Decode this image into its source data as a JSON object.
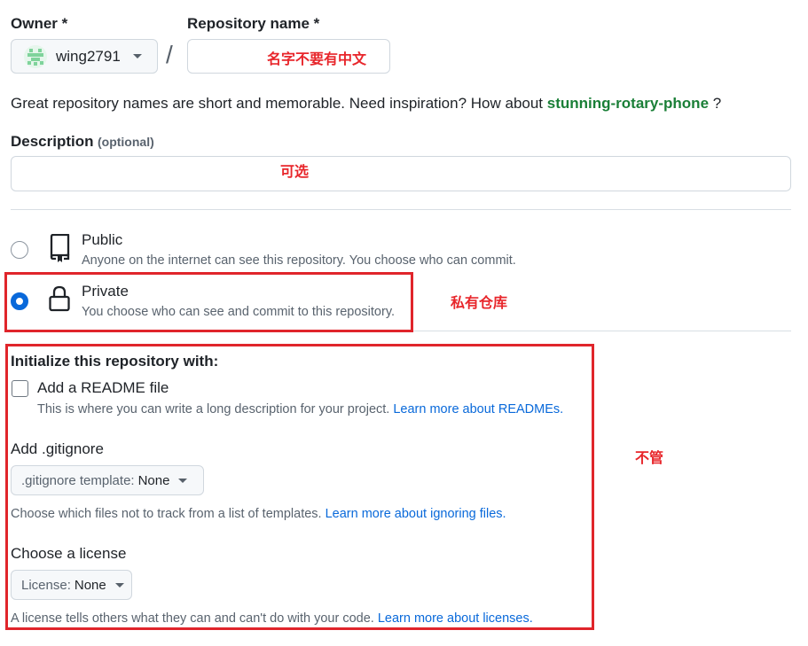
{
  "owner": {
    "label": "Owner *",
    "name": "wing2791"
  },
  "repository": {
    "label": "Repository name *",
    "value": "",
    "annotation": "名字不要有中文"
  },
  "slash": "/",
  "naming_hint": {
    "text": "Great repository names are short and memorable. Need inspiration? How about",
    "suggestion": "stunning-rotary-phone",
    "suffix": "?"
  },
  "description": {
    "label": "Description",
    "optional": "(optional)",
    "value": "",
    "annotation": "可选"
  },
  "visibility": {
    "public": {
      "title": "Public",
      "subtitle": "Anyone on the internet can see this repository. You choose who can commit.",
      "selected": false
    },
    "private": {
      "title": "Private",
      "subtitle": "You choose who can see and commit to this repository.",
      "selected": true,
      "annotation": "私有仓库"
    }
  },
  "initialize": {
    "heading": "Initialize this repository with:",
    "annotation": "不管",
    "readme": {
      "label": "Add a README file",
      "checked": false,
      "help": "This is where you can write a long description for your project.",
      "link": "Learn more about READMEs."
    },
    "gitignore": {
      "heading": "Add .gitignore",
      "select_label": ".gitignore template:",
      "select_value": "None",
      "help": "Choose which files not to track from a list of templates.",
      "link": "Learn more about ignoring files."
    },
    "license": {
      "heading": "Choose a license",
      "select_label": "License:",
      "select_value": "None",
      "help": "A license tells others what they can and can't do with your code.",
      "link": "Learn more about licenses."
    }
  },
  "colors": {
    "accent_blue": "#0969da",
    "suggestion_green": "#1a7f37",
    "annotation_red": "#e0252b"
  },
  "icons": {
    "public": "repo-icon",
    "private": "lock-icon",
    "avatar": "identicon-avatar",
    "dropdown": "triangle-down-icon"
  }
}
